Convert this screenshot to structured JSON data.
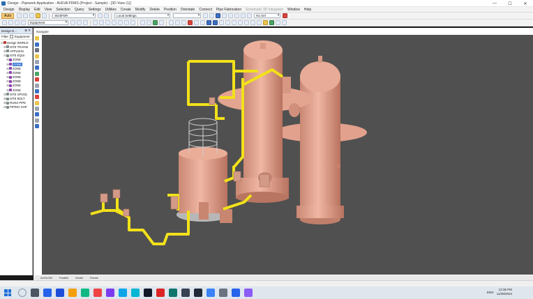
{
  "window": {
    "title": "Design - Pipework Application - AVEVA PDMS (Project - Sample) - [3D View (1)]",
    "controls": [
      "—",
      "☐",
      "✕"
    ]
  },
  "menu": {
    "items": [
      "Design",
      "Display",
      "Edit",
      "View",
      "Selection",
      "Query",
      "Settings",
      "Utilities",
      "Create",
      "Modify",
      "Delete",
      "Position",
      "Orientate",
      "Connect",
      "Pipe Fabrication",
      "Schematic 3D Integrator",
      "Window",
      "Help"
    ]
  },
  "toolbar1": {
    "auto_label": "Auto",
    "spec_combo": "StickFDR",
    "settings_combo": "Local Settings",
    "nofail_combo": "No Sel"
  },
  "toolbar2": {
    "equipment_combo": "Equipment"
  },
  "left_panel": {
    "title": "Design E...",
    "pin": "⊕ ✕",
    "filter_label": "Filter",
    "filter_value": "Equipment",
    "tree": [
      {
        "label": "Design WORLD",
        "depth": 0,
        "exp": "⊟",
        "color": "#c0392b"
      },
      {
        "label": "SITE TRAINS",
        "depth": 1,
        "exp": "⊞",
        "color": "#7f8c8d"
      },
      {
        "label": "APPLDHS",
        "depth": 1,
        "exp": "⊞",
        "color": "#7f8c8d"
      },
      {
        "label": "SITE EQUI",
        "depth": 1,
        "exp": "⊟",
        "color": "#7f8c8d"
      },
      {
        "label": "ZONE",
        "depth": 2,
        "exp": "⊞",
        "color": "#8e44ad"
      },
      {
        "label": "ZONE",
        "depth": 2,
        "exp": "⊞",
        "color": "#8e44ad",
        "selected": true
      },
      {
        "label": "ZONE",
        "depth": 2,
        "exp": "⊞",
        "color": "#8e44ad"
      },
      {
        "label": "ZONE",
        "depth": 2,
        "exp": "⊞",
        "color": "#8e44ad"
      },
      {
        "label": "ZONE",
        "depth": 2,
        "exp": "⊞",
        "color": "#8e44ad"
      },
      {
        "label": "ZONE",
        "depth": 2,
        "exp": "⊞",
        "color": "#8e44ad"
      },
      {
        "label": "ZONE",
        "depth": 2,
        "exp": "⊞",
        "color": "#8e44ad"
      },
      {
        "label": "ZONE",
        "depth": 2,
        "exp": "⊞",
        "color": "#8e44ad"
      },
      {
        "label": "SITE SPOOL",
        "depth": 1,
        "exp": "⊞",
        "color": "#7f8c8d"
      },
      {
        "label": "SITE BOLT",
        "depth": 1,
        "exp": "⊞",
        "color": "#7f8c8d"
      },
      {
        "label": "RUNS PIPE",
        "depth": 1,
        "exp": "⊞",
        "color": "#7f8c8d"
      },
      {
        "label": "PIPING SHP",
        "depth": 1,
        "exp": "⊞",
        "color": "#7f8c8d"
      }
    ]
  },
  "view": {
    "tab_label": "Navigate",
    "colors": {
      "background": "#505050",
      "vessel": "#e8a896",
      "pipe": "#f2e11a"
    }
  },
  "statusbar": {
    "items": [
      "AnOn/Zbl",
      "Parallel",
      "Model",
      "Rotate"
    ]
  },
  "taskbar": {
    "lang": "ENG",
    "time": "12:36 PM",
    "date": "11/28/2024"
  }
}
